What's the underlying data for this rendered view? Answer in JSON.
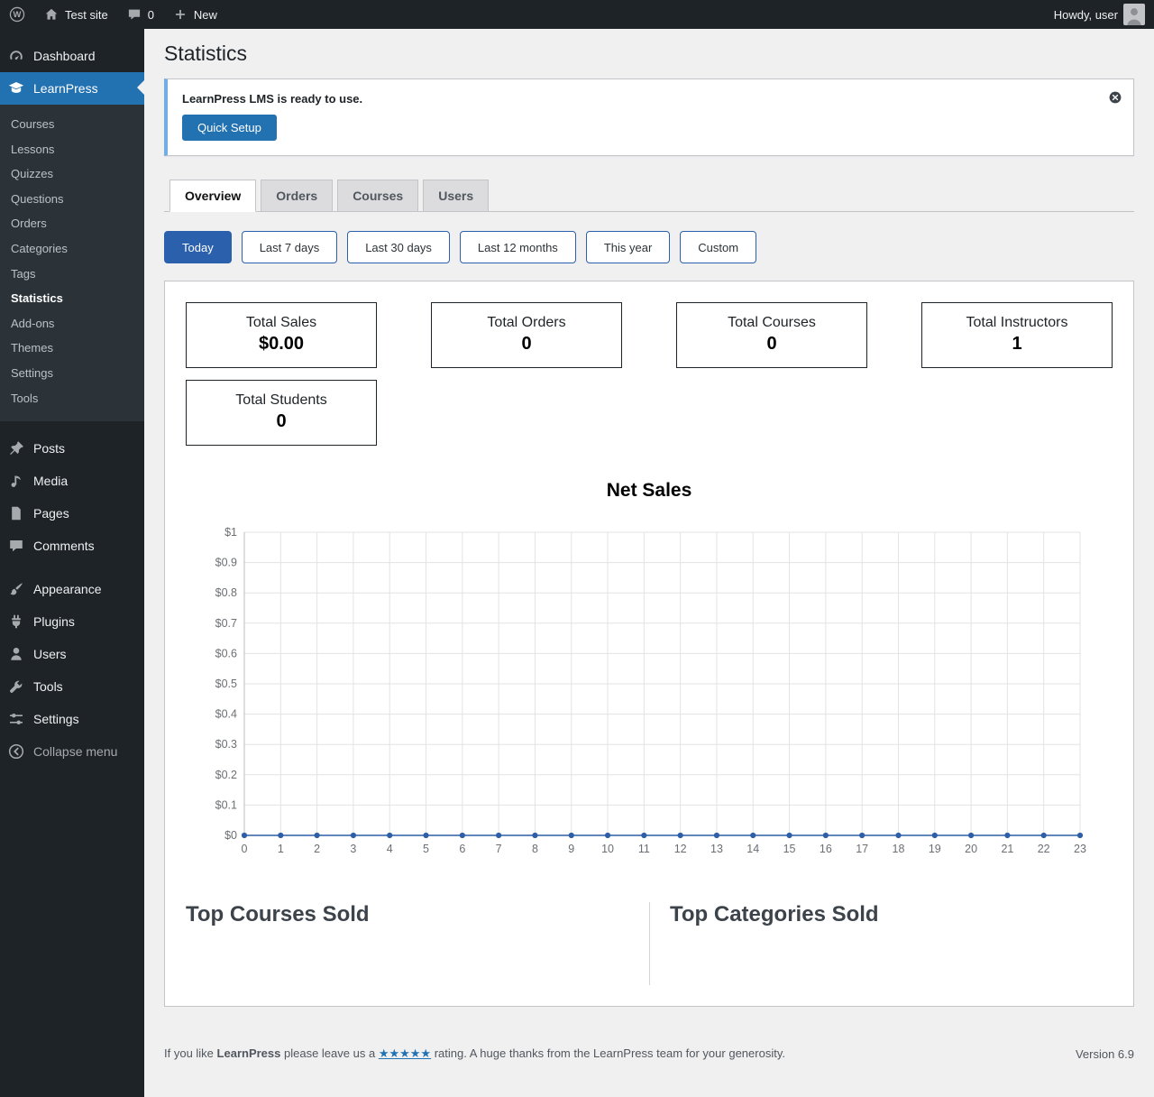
{
  "colors": {
    "accent_blue": "#2271b1",
    "active_filter_blue": "#2b60ad",
    "chart_line_blue": "#2d5fa8",
    "notice_border_blue": "#72aee6",
    "sidebar_bg": "#1d2327",
    "submenu_bg": "#2c3338",
    "content_bg": "#f0f0f1"
  },
  "admin_bar": {
    "site_name": "Test site",
    "comments_count": "0",
    "new_label": "New",
    "howdy_text": "Howdy, user"
  },
  "sidebar": {
    "items": [
      {
        "label": "Dashboard",
        "icon": "dashboard-icon"
      },
      {
        "label": "LearnPress",
        "icon": "learnpress-icon",
        "active": true,
        "submenu": [
          {
            "label": "Courses"
          },
          {
            "label": "Lessons"
          },
          {
            "label": "Quizzes"
          },
          {
            "label": "Questions"
          },
          {
            "label": "Orders"
          },
          {
            "label": "Categories"
          },
          {
            "label": "Tags"
          },
          {
            "label": "Statistics",
            "active": true
          },
          {
            "label": "Add-ons"
          },
          {
            "label": "Themes"
          },
          {
            "label": "Settings"
          },
          {
            "label": "Tools"
          }
        ]
      },
      {
        "separator": true
      },
      {
        "label": "Posts",
        "icon": "posts-icon"
      },
      {
        "label": "Media",
        "icon": "media-icon"
      },
      {
        "label": "Pages",
        "icon": "pages-icon"
      },
      {
        "label": "Comments",
        "icon": "comments-icon"
      },
      {
        "separator": true
      },
      {
        "label": "Appearance",
        "icon": "appearance-icon"
      },
      {
        "label": "Plugins",
        "icon": "plugins-icon"
      },
      {
        "label": "Users",
        "icon": "users-icon"
      },
      {
        "label": "Tools",
        "icon": "tools-icon"
      },
      {
        "label": "Settings",
        "icon": "settings-icon"
      },
      {
        "label": "Collapse menu",
        "icon": "collapse-icon",
        "muted": true
      }
    ]
  },
  "page": {
    "title": "Statistics",
    "notice": {
      "message": "LearnPress LMS is ready to use.",
      "button_label": "Quick Setup"
    },
    "tabs": [
      {
        "label": "Overview",
        "active": true
      },
      {
        "label": "Orders"
      },
      {
        "label": "Courses"
      },
      {
        "label": "Users"
      }
    ],
    "filters": [
      {
        "label": "Today",
        "active": true
      },
      {
        "label": "Last 7 days"
      },
      {
        "label": "Last 30 days"
      },
      {
        "label": "Last 12 months"
      },
      {
        "label": "This year"
      },
      {
        "label": "Custom"
      }
    ],
    "stat_cards": [
      {
        "label": "Total Sales",
        "value": "$0.00"
      },
      {
        "label": "Total Orders",
        "value": "0"
      },
      {
        "label": "Total Courses",
        "value": "0"
      },
      {
        "label": "Total Instructors",
        "value": "1"
      },
      {
        "label": "Total Students",
        "value": "0"
      }
    ],
    "sections": {
      "top_courses_title": "Top Courses Sold",
      "top_categories_title": "Top Categories Sold"
    }
  },
  "chart_data": {
    "type": "line",
    "title": "Net Sales",
    "x": [
      0,
      1,
      2,
      3,
      4,
      5,
      6,
      7,
      8,
      9,
      10,
      11,
      12,
      13,
      14,
      15,
      16,
      17,
      18,
      19,
      20,
      21,
      22,
      23
    ],
    "series": [
      {
        "name": "Net Sales",
        "values": [
          0,
          0,
          0,
          0,
          0,
          0,
          0,
          0,
          0,
          0,
          0,
          0,
          0,
          0,
          0,
          0,
          0,
          0,
          0,
          0,
          0,
          0,
          0,
          0
        ]
      }
    ],
    "xlabel": "",
    "ylabel": "",
    "ylim": [
      0,
      1
    ],
    "ytick_labels": [
      "$0",
      "$0.1",
      "$0.2",
      "$0.3",
      "$0.4",
      "$0.5",
      "$0.6",
      "$0.7",
      "$0.8",
      "$0.9",
      "$1"
    ],
    "grid": true,
    "legend": false,
    "line_color": "#2d5fa8"
  },
  "footer": {
    "prefix": "If you like",
    "brand": "LearnPress",
    "middle": "please leave us a",
    "stars": "★★★★★",
    "suffix": "rating. A huge thanks from the LearnPress team for your generosity.",
    "version": "Version 6.9"
  }
}
